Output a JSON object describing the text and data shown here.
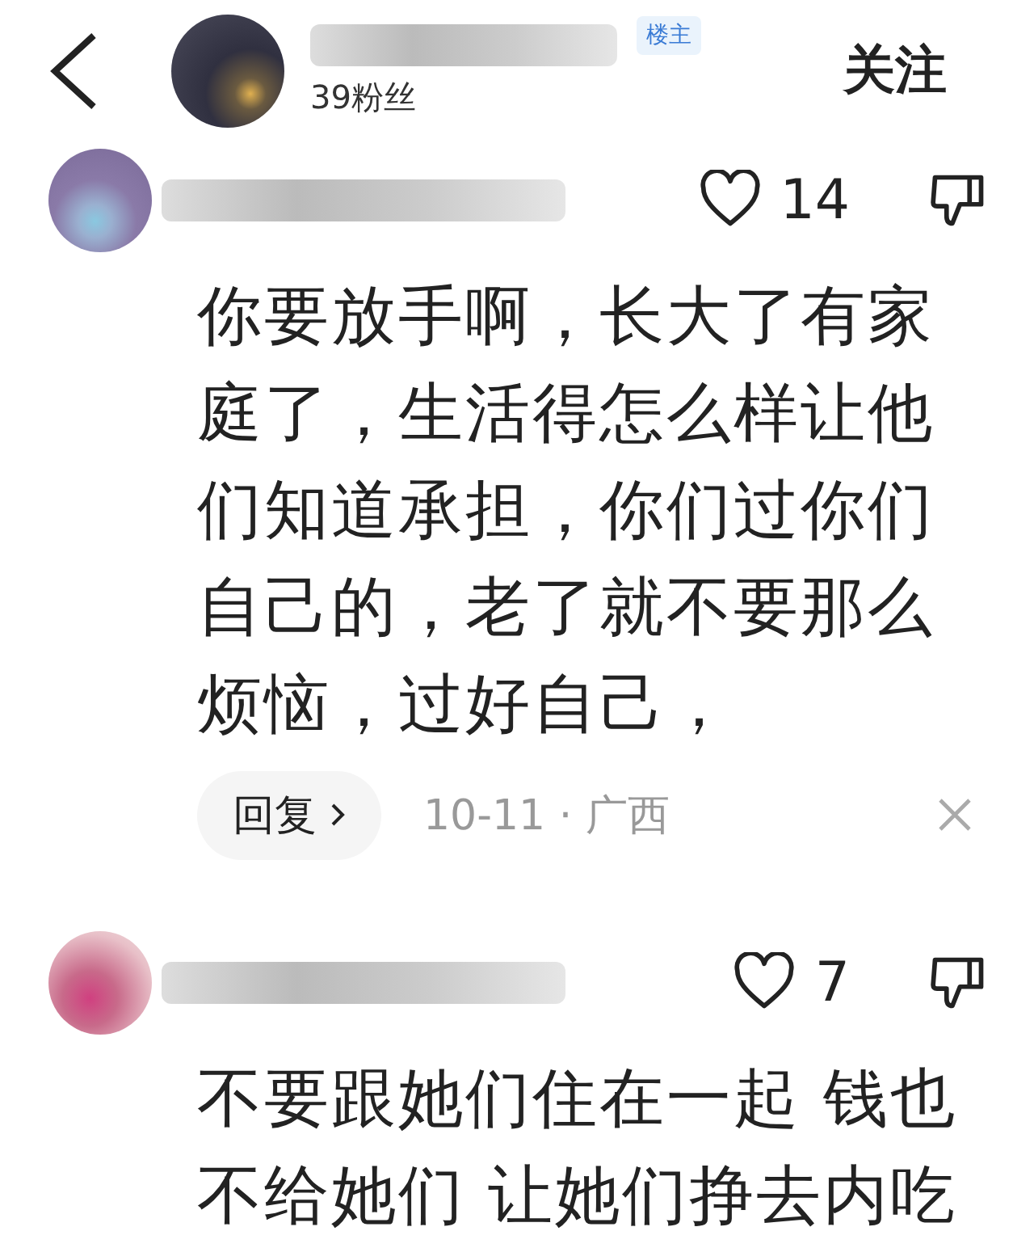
{
  "header": {
    "fans": "39粉丝",
    "badge": "楼主",
    "follow": "关注"
  },
  "comments": [
    {
      "likes": "14",
      "text": "你要放手啊，长大了有家庭了，生活得怎么样让他们知道承担，你们过你们自己的，老了就不要那么烦恼，过好自己，",
      "reply": "回复",
      "meta": "10-11 · 广西"
    },
    {
      "likes": "7",
      "text": "不要跟她们住在一起 钱也不给她们 让她们挣去内吃"
    }
  ]
}
